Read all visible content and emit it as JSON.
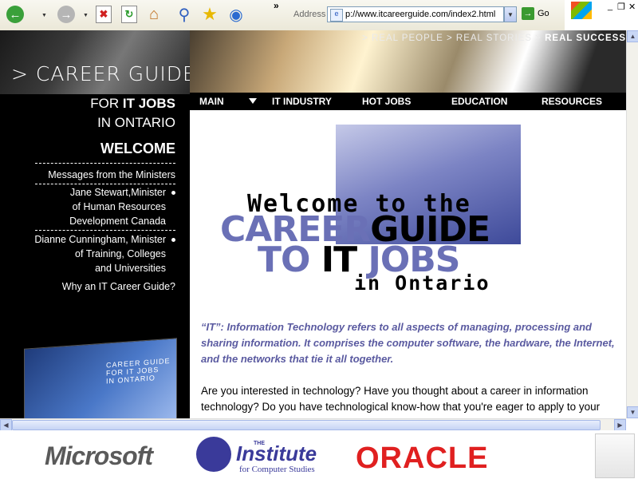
{
  "browser": {
    "address_label": "Address",
    "url": "p://www.itcareerguide.com/index2.html",
    "go_label": "Go",
    "more": "»"
  },
  "sidebar": {
    "brand": "> CAREER GUIDE",
    "subtitle_prefix": "FOR",
    "subtitle_strong": "IT JOBS",
    "subtitle_2": "IN ONTARIO",
    "welcome": "WELCOME",
    "links": [
      {
        "label": "Messages from the Ministers"
      },
      {
        "label": "Jane Stewart,Minister\nof Human Resources\nDevelopment Canada"
      },
      {
        "label": "Dianne Cunningham, Minister\nof Training, Colleges\nand Universities"
      },
      {
        "label": "Why an IT Career Guide?"
      }
    ],
    "book_title": "CAREER GUIDE\nFOR IT JOBS\nIN ONTARIO"
  },
  "banner": {
    "tagline_1": "> REAL PEOPLE > REAL STORIES > ",
    "tagline_strong": "REAL SUCCESS"
  },
  "menu": {
    "items": [
      "MAIN",
      "IT INDUSTRY",
      "HOT JOBS",
      "EDUCATION",
      "RESOURCES"
    ]
  },
  "main": {
    "welcome_line": "Welcome to the",
    "career": "CAREER",
    "guide": "GUIDE",
    "to": "TO",
    "it": "IT",
    "jobs": "JOBS",
    "in_ontario": "in Ontario",
    "definition": "“IT”: Information Technology refers to all aspects of managing, processing and sharing information. It comprises the computer software, the hardware, the Internet, and the networks that tie it all together.",
    "intro": "Are you interested in technology? Have you thought about a career in information technology? Do you have technological know-how that you're eager to apply to your"
  },
  "sponsors": {
    "microsoft": "Microsoft",
    "ics_the": "THE",
    "ics_title": "Institute",
    "ics_sub": "for Computer Studies",
    "oracle": "ORACLE"
  },
  "colors": {
    "accent_blue": "#6a70b6",
    "oracle_red": "#e02020",
    "sidebar_bg": "#000000"
  }
}
